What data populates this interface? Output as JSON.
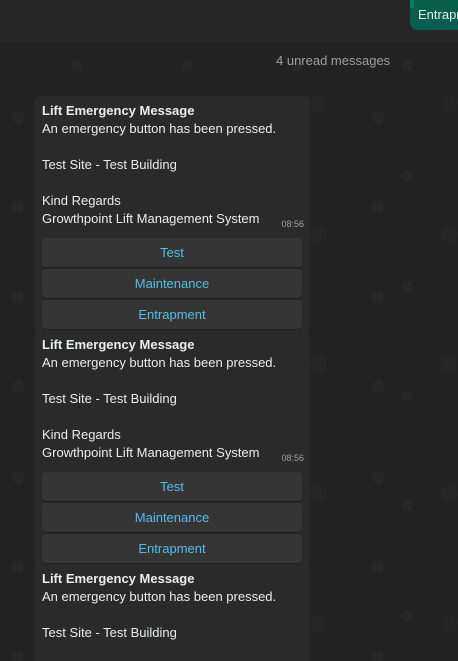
{
  "top_bubble": {
    "label": "Entrapr"
  },
  "unread": {
    "text": "4 unread messages"
  },
  "messages": [
    {
      "title": "Lift Emergency Message",
      "line1": "An emergency button has been pressed.",
      "line2": "Test Site - Test Building",
      "line3": "Kind Regards",
      "line4": "Growthpoint Lift Management System",
      "time": "08:56",
      "buttons": [
        "Test",
        "Maintenance",
        "Entrapment"
      ]
    },
    {
      "title": "Lift Emergency Message",
      "line1": "An emergency button has been pressed.",
      "line2": "Test Site - Test Building",
      "line3": "Kind Regards",
      "line4": "Growthpoint Lift Management System",
      "time": "08:56",
      "buttons": [
        "Test",
        "Maintenance",
        "Entrapment"
      ]
    },
    {
      "title": "Lift Emergency Message",
      "line1": "An emergency button has been pressed.",
      "line2": "Test Site - Test Building"
    }
  ],
  "colors": {
    "background": "#222222",
    "bubble": "#2a2a2a",
    "button_text": "#53bdeb",
    "outgoing": "#075e4c"
  }
}
